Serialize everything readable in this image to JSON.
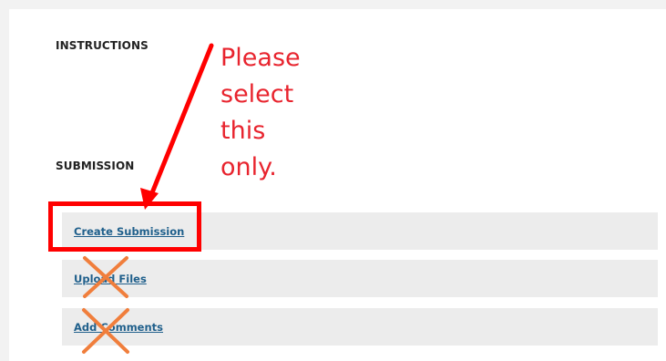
{
  "instructions_heading": "INSTRUCTIONS",
  "submission_heading": "SUBMISSION",
  "links": {
    "create_submission": "Create Submission",
    "upload_files": "Upload Files",
    "add_comments": "Add Comments"
  },
  "annotation": {
    "lines": [
      "Please",
      "select",
      "this",
      "only."
    ],
    "color": "#e8242e",
    "cross_color": "#f07e3c"
  },
  "colors": {
    "link": "#1f5f8b",
    "row_bg": "#ececec",
    "highlight": "#ff0000"
  }
}
